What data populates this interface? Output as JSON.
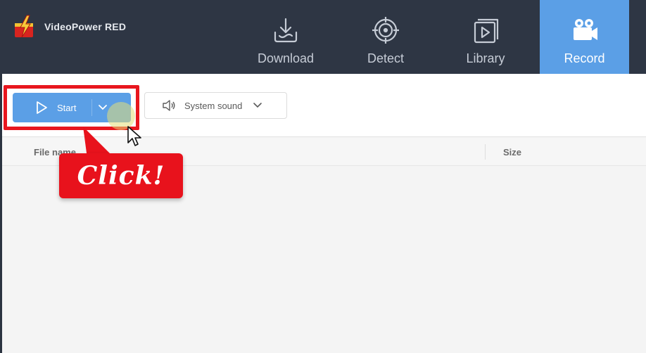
{
  "app": {
    "name": "VideoPower RED"
  },
  "nav": {
    "items": [
      {
        "label": "Download",
        "icon": "download-icon"
      },
      {
        "label": "Detect",
        "icon": "target-icon"
      },
      {
        "label": "Library",
        "icon": "library-icon"
      },
      {
        "label": "Record",
        "icon": "video-camera-icon",
        "active": true
      }
    ]
  },
  "toolbar": {
    "start_label": "Start",
    "sound_label": "System sound"
  },
  "table": {
    "columns": [
      "File name",
      "Size"
    ]
  },
  "callout": {
    "text": "Click!"
  },
  "colors": {
    "header_bg": "#2e3644",
    "accent": "#5b9fe6",
    "highlight": "#e8161e"
  }
}
